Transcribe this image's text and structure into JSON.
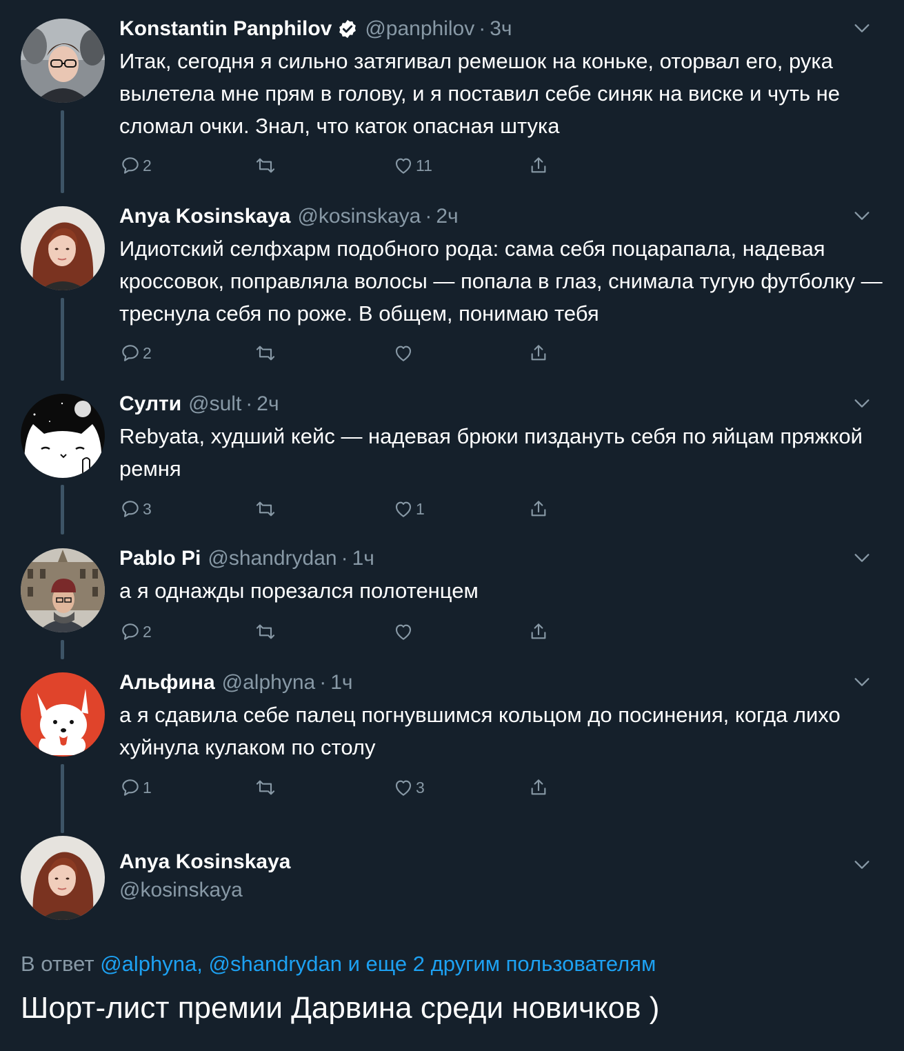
{
  "colors": {
    "background": "#15202b",
    "text_primary": "#ffffff",
    "text_secondary": "#8899a6",
    "accent": "#1da1f2",
    "thread_line": "#3d5466"
  },
  "tweets": [
    {
      "name": "Konstantin Panphilov",
      "verified": true,
      "handle": "@panphilov",
      "time": "3ч",
      "text": "Итак, сегодня я сильно затягивал ремешок на коньке, оторвал его, рука вылетела мне прям в голову, и я поставил себе синяк на виске и чуть не сломал очки. Знал, что каток опасная штука",
      "replies": "2",
      "retweets": "",
      "likes": "11"
    },
    {
      "name": "Anya Kosinskaya",
      "verified": false,
      "handle": "@kosinskaya",
      "time": "2ч",
      "text": "Идиотский селфхарм подобного рода: сама себя поцарапала, надевая кроссовок, поправляла волосы — попала в глаз, снимала тугую футболку — треснула себя по роже. В общем, понимаю тебя",
      "replies": "2",
      "retweets": "",
      "likes": ""
    },
    {
      "name": "Султи",
      "verified": false,
      "handle": "@sult",
      "time": "2ч",
      "text": "Rebyata, худший кейс — надевая брюки пиздануть себя по яйцам пряжкой ремня",
      "replies": "3",
      "retweets": "",
      "likes": "1"
    },
    {
      "name": "Pablo Pi",
      "verified": false,
      "handle": "@shandrydan",
      "time": "1ч",
      "text": "а я однажды порезался полотенцем",
      "replies": "2",
      "retweets": "",
      "likes": ""
    },
    {
      "name": "Альфина",
      "verified": false,
      "handle": "@alphyna",
      "time": "1ч",
      "text": "а я сдавила себе палец погнувшимся кольцом до посинения, когда лихо хуйнула кулаком по столу",
      "replies": "1",
      "retweets": "",
      "likes": "3"
    }
  ],
  "main_tweet": {
    "name": "Anya Kosinskaya",
    "handle": "@kosinskaya",
    "reply_prefix": "В ответ ",
    "reply_mentions": "@alphyna, @shandrydan и еще 2 другим пользователям",
    "text": "Шорт-лист премии Дарвина среди новичков )"
  },
  "separator": "·",
  "icons": {
    "verified": "verified-badge-icon",
    "chevron": "chevron-down-icon",
    "reply": "reply-icon",
    "retweet": "retweet-icon",
    "like": "heart-icon",
    "share": "share-icon"
  }
}
